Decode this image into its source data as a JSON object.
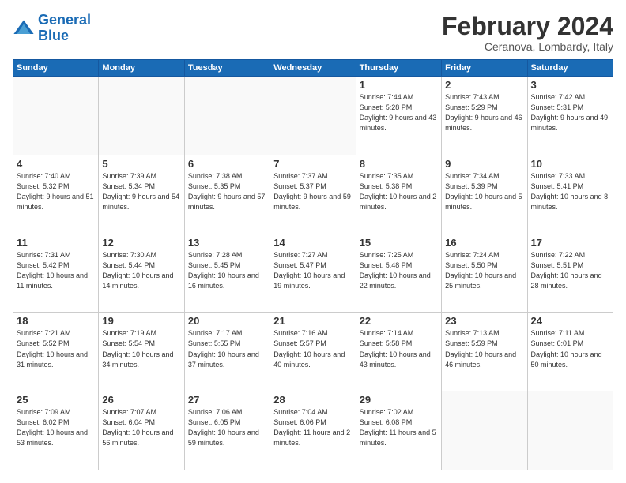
{
  "logo": {
    "line1": "General",
    "line2": "Blue"
  },
  "title": "February 2024",
  "subtitle": "Ceranova, Lombardy, Italy",
  "days_of_week": [
    "Sunday",
    "Monday",
    "Tuesday",
    "Wednesday",
    "Thursday",
    "Friday",
    "Saturday"
  ],
  "weeks": [
    [
      {
        "day": "",
        "info": ""
      },
      {
        "day": "",
        "info": ""
      },
      {
        "day": "",
        "info": ""
      },
      {
        "day": "",
        "info": ""
      },
      {
        "day": "1",
        "info": "Sunrise: 7:44 AM\nSunset: 5:28 PM\nDaylight: 9 hours\nand 43 minutes."
      },
      {
        "day": "2",
        "info": "Sunrise: 7:43 AM\nSunset: 5:29 PM\nDaylight: 9 hours\nand 46 minutes."
      },
      {
        "day": "3",
        "info": "Sunrise: 7:42 AM\nSunset: 5:31 PM\nDaylight: 9 hours\nand 49 minutes."
      }
    ],
    [
      {
        "day": "4",
        "info": "Sunrise: 7:40 AM\nSunset: 5:32 PM\nDaylight: 9 hours\nand 51 minutes."
      },
      {
        "day": "5",
        "info": "Sunrise: 7:39 AM\nSunset: 5:34 PM\nDaylight: 9 hours\nand 54 minutes."
      },
      {
        "day": "6",
        "info": "Sunrise: 7:38 AM\nSunset: 5:35 PM\nDaylight: 9 hours\nand 57 minutes."
      },
      {
        "day": "7",
        "info": "Sunrise: 7:37 AM\nSunset: 5:37 PM\nDaylight: 9 hours\nand 59 minutes."
      },
      {
        "day": "8",
        "info": "Sunrise: 7:35 AM\nSunset: 5:38 PM\nDaylight: 10 hours\nand 2 minutes."
      },
      {
        "day": "9",
        "info": "Sunrise: 7:34 AM\nSunset: 5:39 PM\nDaylight: 10 hours\nand 5 minutes."
      },
      {
        "day": "10",
        "info": "Sunrise: 7:33 AM\nSunset: 5:41 PM\nDaylight: 10 hours\nand 8 minutes."
      }
    ],
    [
      {
        "day": "11",
        "info": "Sunrise: 7:31 AM\nSunset: 5:42 PM\nDaylight: 10 hours\nand 11 minutes."
      },
      {
        "day": "12",
        "info": "Sunrise: 7:30 AM\nSunset: 5:44 PM\nDaylight: 10 hours\nand 14 minutes."
      },
      {
        "day": "13",
        "info": "Sunrise: 7:28 AM\nSunset: 5:45 PM\nDaylight: 10 hours\nand 16 minutes."
      },
      {
        "day": "14",
        "info": "Sunrise: 7:27 AM\nSunset: 5:47 PM\nDaylight: 10 hours\nand 19 minutes."
      },
      {
        "day": "15",
        "info": "Sunrise: 7:25 AM\nSunset: 5:48 PM\nDaylight: 10 hours\nand 22 minutes."
      },
      {
        "day": "16",
        "info": "Sunrise: 7:24 AM\nSunset: 5:50 PM\nDaylight: 10 hours\nand 25 minutes."
      },
      {
        "day": "17",
        "info": "Sunrise: 7:22 AM\nSunset: 5:51 PM\nDaylight: 10 hours\nand 28 minutes."
      }
    ],
    [
      {
        "day": "18",
        "info": "Sunrise: 7:21 AM\nSunset: 5:52 PM\nDaylight: 10 hours\nand 31 minutes."
      },
      {
        "day": "19",
        "info": "Sunrise: 7:19 AM\nSunset: 5:54 PM\nDaylight: 10 hours\nand 34 minutes."
      },
      {
        "day": "20",
        "info": "Sunrise: 7:17 AM\nSunset: 5:55 PM\nDaylight: 10 hours\nand 37 minutes."
      },
      {
        "day": "21",
        "info": "Sunrise: 7:16 AM\nSunset: 5:57 PM\nDaylight: 10 hours\nand 40 minutes."
      },
      {
        "day": "22",
        "info": "Sunrise: 7:14 AM\nSunset: 5:58 PM\nDaylight: 10 hours\nand 43 minutes."
      },
      {
        "day": "23",
        "info": "Sunrise: 7:13 AM\nSunset: 5:59 PM\nDaylight: 10 hours\nand 46 minutes."
      },
      {
        "day": "24",
        "info": "Sunrise: 7:11 AM\nSunset: 6:01 PM\nDaylight: 10 hours\nand 50 minutes."
      }
    ],
    [
      {
        "day": "25",
        "info": "Sunrise: 7:09 AM\nSunset: 6:02 PM\nDaylight: 10 hours\nand 53 minutes."
      },
      {
        "day": "26",
        "info": "Sunrise: 7:07 AM\nSunset: 6:04 PM\nDaylight: 10 hours\nand 56 minutes."
      },
      {
        "day": "27",
        "info": "Sunrise: 7:06 AM\nSunset: 6:05 PM\nDaylight: 10 hours\nand 59 minutes."
      },
      {
        "day": "28",
        "info": "Sunrise: 7:04 AM\nSunset: 6:06 PM\nDaylight: 11 hours\nand 2 minutes."
      },
      {
        "day": "29",
        "info": "Sunrise: 7:02 AM\nSunset: 6:08 PM\nDaylight: 11 hours\nand 5 minutes."
      },
      {
        "day": "",
        "info": ""
      },
      {
        "day": "",
        "info": ""
      }
    ]
  ]
}
